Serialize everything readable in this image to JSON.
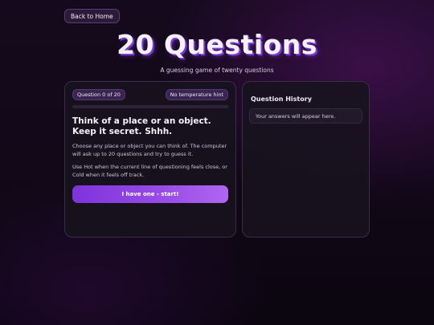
{
  "nav": {
    "back_label": "Back to Home"
  },
  "header": {
    "title": "20 Questions",
    "subtitle": "A guessing game of twenty questions"
  },
  "game": {
    "question_badge": "Question 0 of 20",
    "hint_badge": "No temperature hint",
    "progress_fraction": 0,
    "heading": "Think of a place or an object. Keep it secret. Shhh.",
    "instructions": [
      "Choose any place or object you can think of. The computer will ask up to 20 questions and try to guess it.",
      "Use Hot when the current line of questioning feels close, or Cold when it feels off track."
    ],
    "start_label": "I have one - start!"
  },
  "history": {
    "title": "Question History",
    "empty_text": "Your answers will appear here."
  },
  "colors": {
    "accent": "#a855f7",
    "accent_dark": "#7e34dc",
    "panel_bg": "#18121e",
    "badge_bg": "#3a2550"
  }
}
